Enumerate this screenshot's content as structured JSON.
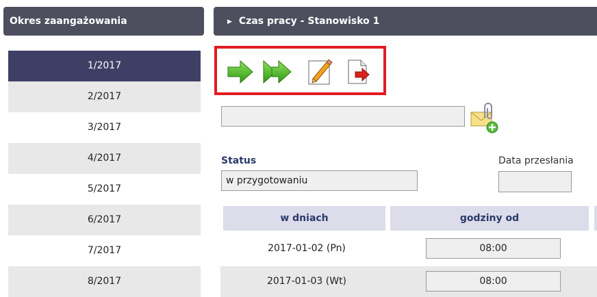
{
  "left_panel": {
    "title": "Okres zaangażowania",
    "periods": [
      "1/2017",
      "2/2017",
      "3/2017",
      "4/2017",
      "5/2017",
      "6/2017",
      "7/2017",
      "8/2017"
    ],
    "selected_period": "1/2017"
  },
  "right_panel": {
    "title": "Czas pracy - Stanowisko 1"
  },
  "toolbar": {
    "buttons": [
      "green-arrow-next-icon",
      "green-double-arrow-icon",
      "pencil-edit-icon",
      "document-export-icon"
    ]
  },
  "attachment": {
    "value": "",
    "icon": "paperclip-envelope-add-icon"
  },
  "status": {
    "label": "Status",
    "value": "w przygotowaniu",
    "date_label": "Data przesłania",
    "date_value": ""
  },
  "table": {
    "headers": [
      "w dniach",
      "godziny od"
    ],
    "rows": [
      {
        "date": "2017-01-02 (Pn)",
        "from": "08:00"
      },
      {
        "date": "2017-01-03 (Wt)",
        "from": "08:00"
      }
    ]
  },
  "colors": {
    "header_bg": "#4d4e5e",
    "selected_bg": "#3f3f66",
    "highlight_border": "#e21b23",
    "table_header_bg": "#dcdcea"
  }
}
